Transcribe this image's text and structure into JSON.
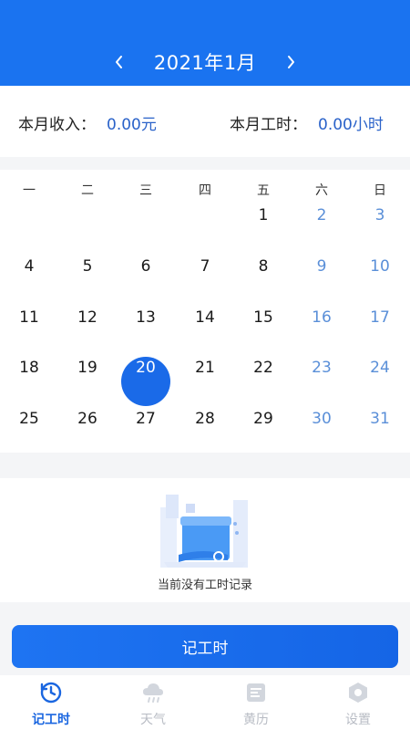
{
  "header": {
    "month_title": "2021年1月",
    "prev_arrow": "‹",
    "next_arrow": "›"
  },
  "summary": {
    "income_label": "本月收入：",
    "income_value": "0.00元",
    "hours_label": "本月工时：",
    "hours_value": "0.00小时"
  },
  "calendar": {
    "weekdays": [
      "一",
      "二",
      "三",
      "四",
      "五",
      "六",
      "日"
    ],
    "weeks": [
      [
        "",
        "",
        "",
        "",
        "1",
        "2",
        "3"
      ],
      [
        "4",
        "5",
        "6",
        "7",
        "8",
        "9",
        "10"
      ],
      [
        "11",
        "12",
        "13",
        "14",
        "15",
        "16",
        "17"
      ],
      [
        "18",
        "19",
        "20",
        "21",
        "22",
        "23",
        "24"
      ],
      [
        "25",
        "26",
        "27",
        "28",
        "29",
        "30",
        "31"
      ]
    ],
    "selected_day": "20"
  },
  "empty": {
    "message": "当前没有工时记录"
  },
  "actions": {
    "record_label": "记工时"
  },
  "tabbar": {
    "tabs": [
      {
        "label": "记工时",
        "icon": "clock-refresh-icon",
        "active": true
      },
      {
        "label": "天气",
        "icon": "cloud-rain-icon",
        "active": false
      },
      {
        "label": "黄历",
        "icon": "almanac-book-icon",
        "active": false
      },
      {
        "label": "设置",
        "icon": "settings-hexagon-icon",
        "active": false
      }
    ]
  },
  "colors": {
    "primary": "#1a73f0",
    "weekend": "#5a8fd8",
    "value_text": "#2a62c9",
    "tab_inactive": "#b8bcc4"
  }
}
